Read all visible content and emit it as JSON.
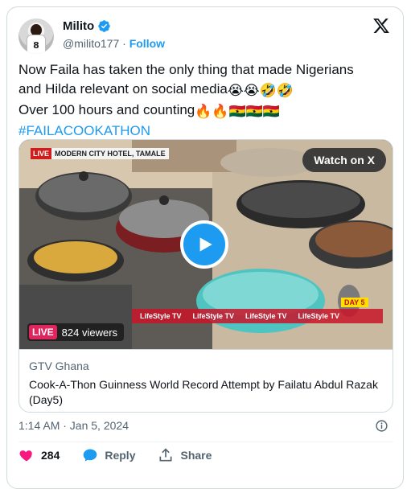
{
  "author": {
    "name": "Milito",
    "handle": "@milito177",
    "separator": "·",
    "follow_label": "Follow",
    "avatar_number": "8",
    "verified_color": "#1d9bf0"
  },
  "tweet": {
    "line1": "Now Faila has taken the only thing that made Nigerians",
    "line2": "and Hilda relevant on social media",
    "line2_emojis": "😭😭🤣🤣",
    "line3": "Over 100 hours and counting",
    "line3_emojis": "🔥🔥🇬🇭🇬🇭🇬🇭",
    "hashtag": "#FAILACOOKATHON"
  },
  "media": {
    "watch_label": "Watch on X",
    "live_tag": "LIVE",
    "viewers": "824 viewers",
    "broadcast_live": "LIVE",
    "broadcast_location": "MODERN CITY HOTEL, TAMALE",
    "day_badge": "DAY 5",
    "ticker_items": [
      "LifeStyle TV",
      "LifeStyle TV",
      "LifeStyle TV",
      "LifeStyle TV"
    ],
    "source": "GTV Ghana",
    "title": "Cook-A-Thon Guinness World Record Attempt by Failatu Abdul Razak (Day5)"
  },
  "footer": {
    "timestamp": "1:14 AM · Jan 5, 2024",
    "likes": "284",
    "reply_label": "Reply",
    "share_label": "Share",
    "like_color": "#f91880",
    "reply_color": "#1d9bf0"
  }
}
